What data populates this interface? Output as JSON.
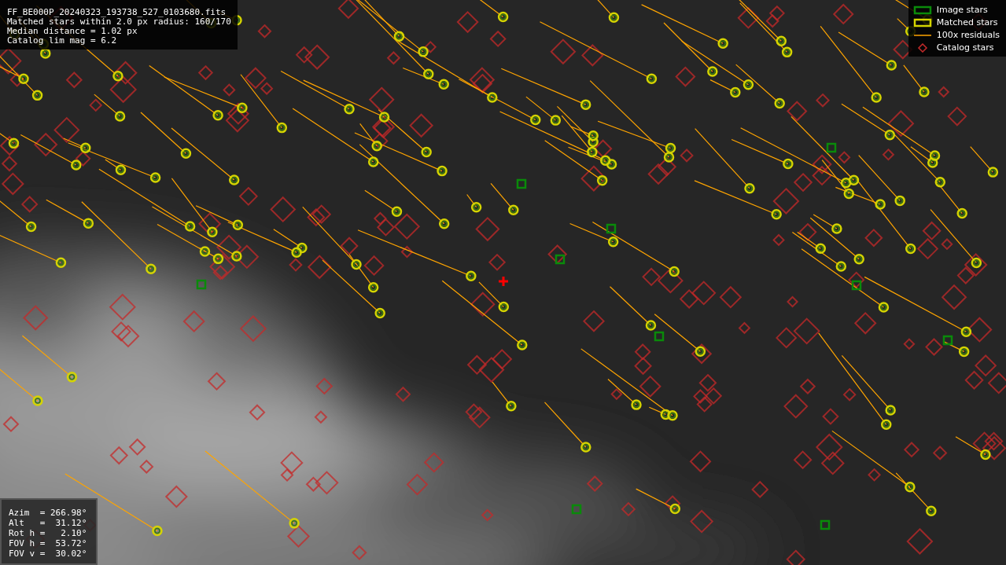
{
  "header": {
    "lines": [
      "FF_BE000P_20240323_193738_527_0103680.fits",
      "Matched stars within 2.0 px radius: 160/170",
      "Median distance = 1.02 px",
      "Catalog lim mag = 6.2"
    ]
  },
  "legend": [
    {
      "kind": "image",
      "label": "Image stars"
    },
    {
      "kind": "matched",
      "label": "Matched stars"
    },
    {
      "kind": "residual",
      "label": "100x residuals"
    },
    {
      "kind": "catalog",
      "label": "Catalog stars"
    }
  ],
  "pointing": {
    "lines": [
      "Azim  = 266.98°",
      "Alt   =  31.12°",
      "Rot h =   2.10°",
      "FOV h =  53.72°",
      "FOV v =  30.02°"
    ]
  }
}
